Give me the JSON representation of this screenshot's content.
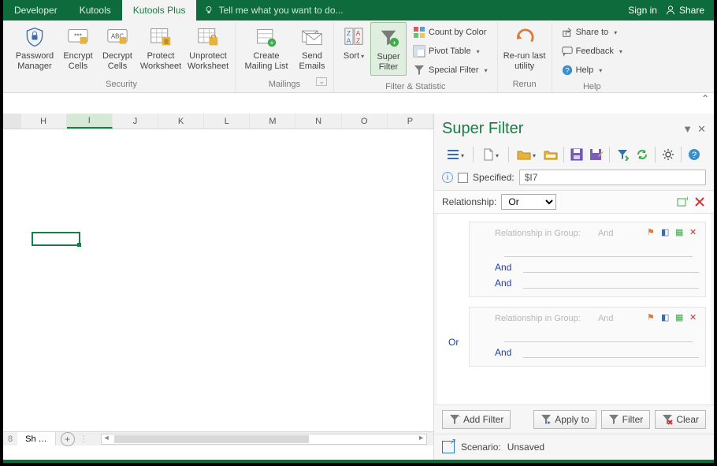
{
  "titlebar": {
    "tabs": [
      "Developer",
      "Kutools",
      "Kutools Plus"
    ],
    "active_tab_index": 2,
    "tellme_placeholder": "Tell me what you want to do...",
    "signin": "Sign in",
    "share": "Share"
  },
  "ribbon": {
    "groups": [
      {
        "label": "Security",
        "items": [
          "Password Manager",
          "Encrypt Cells",
          "Decrypt Cells",
          "Protect Worksheet",
          "Unprotect Worksheet"
        ]
      },
      {
        "label": "Mailings",
        "items": [
          "Create Mailing List",
          "Send Emails"
        ]
      },
      {
        "label": "Filter & Statistic",
        "sort": "Sort",
        "superfilter": "Super Filter",
        "small": [
          "Count by Color",
          "Pivot Table",
          "Special Filter"
        ]
      },
      {
        "label": "Rerun",
        "items": [
          "Re-run last utility"
        ]
      },
      {
        "label": "Help",
        "small": [
          "Share to",
          "Feedback",
          "Help"
        ]
      }
    ]
  },
  "columns": [
    "H",
    "I",
    "J",
    "K",
    "L",
    "M",
    "N",
    "O",
    "P"
  ],
  "selected_col_index": 1,
  "sheet_tab": "Sh",
  "pane": {
    "title": "Super Filter",
    "specified_label": "Specified:",
    "specified_value": "$I7",
    "relationship_label": "Relationship:",
    "relationship_value": "Or",
    "group_header_label": "Relationship in Group:",
    "group_header_value": "And",
    "and_label": "And",
    "or_label": "Or",
    "buttons": {
      "add": "Add Filter",
      "apply": "Apply to",
      "filter": "Filter",
      "clear": "Clear"
    },
    "scenario_label": "Scenario:",
    "scenario_value": "Unsaved"
  }
}
